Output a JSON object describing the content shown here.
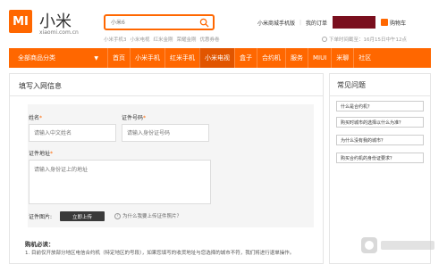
{
  "header": {
    "logo_mark": "MI",
    "brand_name": "小米",
    "brand_url": "xiaomi.com.cn",
    "search_placeholder": "小米6",
    "hot_words": [
      "小米手机3",
      "小米电视",
      "红米金刚",
      "荣耀金刚",
      "优惠券卷"
    ],
    "top_links": [
      "小米商城手机版",
      "我的订单"
    ],
    "cart_label": "购物车",
    "delivery_note": "下单时间截至：16月15日中午12点"
  },
  "nav": {
    "category_label": "全部商品分类",
    "items": [
      "首页",
      "小米手机",
      "红米手机",
      "小米电视",
      "盒子",
      "合约机",
      "服务",
      "MIUI",
      "米聊",
      "社区"
    ],
    "active_index": 3
  },
  "form": {
    "title": "填写入网信息",
    "name_label": "姓名",
    "name_placeholder": "请输入中文姓名",
    "id_label": "证件号码",
    "id_placeholder": "请输入身份证号码",
    "address_label": "证件地址",
    "address_placeholder": "请输入身份证上的地址",
    "photo_label": "证件图片:",
    "upload_label": "立即上传",
    "why_label": "为什么我要上传证件照片？",
    "notice_title": "购机必读：",
    "notice_text": "1. 目前仅开放部分地区电信合约机（特定地区的号段），如果您填写的收货地址与您选择的城市不符，我们将进行退单操作。"
  },
  "faq": {
    "title": "常见问题",
    "items": [
      "什么是合约机？",
      "购买时城市的选择以什么为准？",
      "为什么没有我的城市？",
      "购买合约机的身份证要求？"
    ]
  },
  "colors": {
    "accent": "#ff6700",
    "user_block": "#7a0f1e"
  }
}
